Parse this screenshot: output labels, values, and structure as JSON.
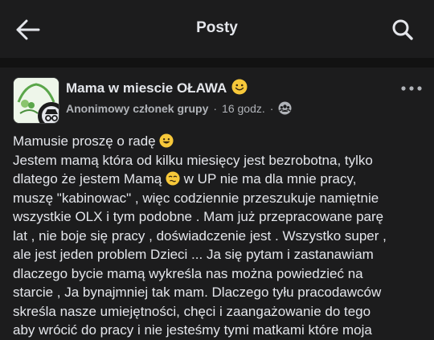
{
  "header": {
    "title": "Posty",
    "back_icon": "back-arrow-icon",
    "search_icon": "search-icon"
  },
  "post": {
    "group_name": "Mama w miescie OŁAWA",
    "author": "Anonimowy członek grupy",
    "separator": "·",
    "time": "16 godz.",
    "separator2": "·",
    "audience_icon": "group-icon",
    "more_icon": "more-icon",
    "lines": [
      "Mamusie proszę o radę",
      "Jestem mamą która od kilku miesięcy jest bezrobotna, tylko",
      "dlatego że jestem Mamą",
      "muszę \"kabinowac\" , więc codziennie przeszukuje namiętnie",
      "wszystkie OLX i tym podobne . Mam już przepracowane parę",
      "lat , nie boje się pracy , doświadczenie jest . Wszystko super ,",
      "ale jest jeden problem Dzieci ... Ja się pytam i zastanawiam",
      "dlaczego bycie mamą wykreśla nas można powiedzieć na",
      "starcie , Ja bynajmniej tak mam. Dlaczego tyłu pracodawców",
      "skreśla nasze umiejętności, chęci i zaangażowanie do tego",
      "aby wrócić do pracy i nie jesteśmy tymi matkami które moja"
    ],
    "line3_suffix": " w UP nie ma dla mnie pracy,"
  },
  "colors": {
    "background": "#1c1c1d",
    "text": "#e4e6eb",
    "secondary": "#b0b3b8",
    "emoji": "#f7c83a"
  }
}
